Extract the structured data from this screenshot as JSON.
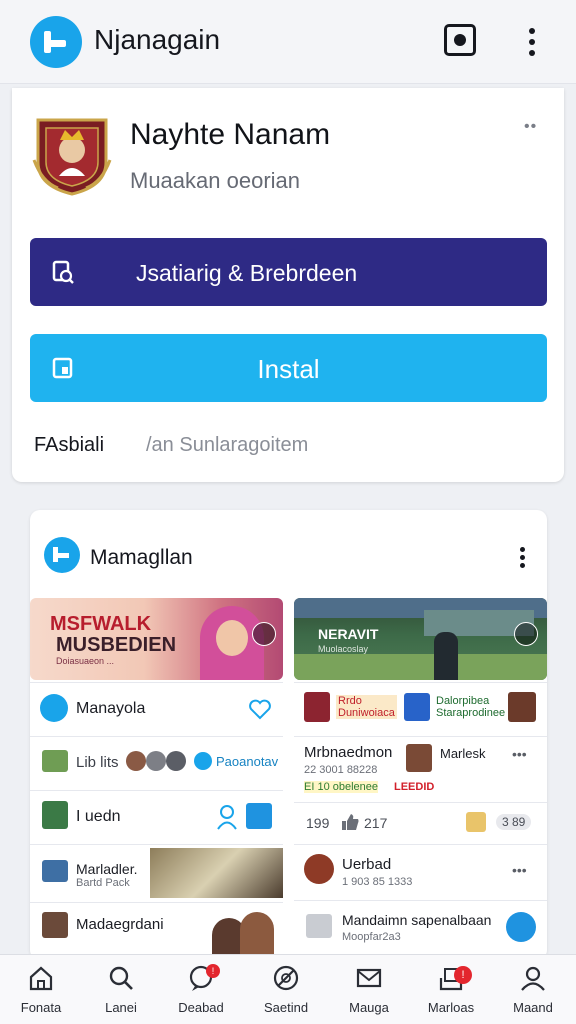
{
  "header": {
    "title": "Njanagain",
    "icons": [
      "app-logo-icon",
      "camera-icon",
      "more-vert-icon"
    ]
  },
  "app": {
    "name": "Nayhte Nanam",
    "developer": "Muaakan oeorian",
    "primary_button": "Jsatiarig & Brebrdeen",
    "install_button": "Instal",
    "footer_left": "FAsbiali",
    "footer_right": "/an Sunlaragoitem",
    "colors": {
      "primary": "#2e2a85",
      "install": "#1fb3ef",
      "accent": "#19a4ea"
    }
  },
  "feed": {
    "title": "Mamagllan",
    "left_thumb": {
      "line1": "MSFWALK",
      "line2": "MUSBEDIEN",
      "line3": "Doiasuaeon ..."
    },
    "right_thumb": {
      "line1": "NERAVIT",
      "line2": "Muolacoslay"
    },
    "left_rows": [
      {
        "label": "Manayola"
      },
      {
        "label": "Lib lits",
        "chip": "Paoanotav"
      },
      {
        "label": "I uedn"
      },
      {
        "label": "Marladler.",
        "sub": "Bartd Pack"
      },
      {
        "label": "Madaegrdani"
      }
    ],
    "right_rows": {
      "banner_left": "Rrdo\nDuniwoiaca",
      "banner_right": "Dalorpibea\nStaraprodinee",
      "post_title": "Mrbnaedmon",
      "post_author": "Marlesk",
      "post_meta": "22 3001 88228",
      "post_tag": "EI 10 obelenee",
      "post_tag_red": "LEEDID",
      "likes": "199",
      "comments": "217",
      "views": "3 89",
      "user_name": "Uerbad",
      "user_meta": "1 903 85 1333",
      "last_title": "Mandaimn sapenalbaan",
      "last_meta": "Moopfar2a3"
    }
  },
  "nav": [
    {
      "label": "Fonata",
      "icon": "home-icon"
    },
    {
      "label": "Lanei",
      "icon": "search-icon"
    },
    {
      "label": "Deabad",
      "icon": "chat-icon",
      "badge": "!"
    },
    {
      "label": "Saetind",
      "icon": "no-settings-icon"
    },
    {
      "label": "Mauga",
      "icon": "mail-icon"
    },
    {
      "label": "Marloas",
      "icon": "inbox-icon",
      "badge": "!"
    },
    {
      "label": "Maand",
      "icon": "profile-icon"
    }
  ]
}
